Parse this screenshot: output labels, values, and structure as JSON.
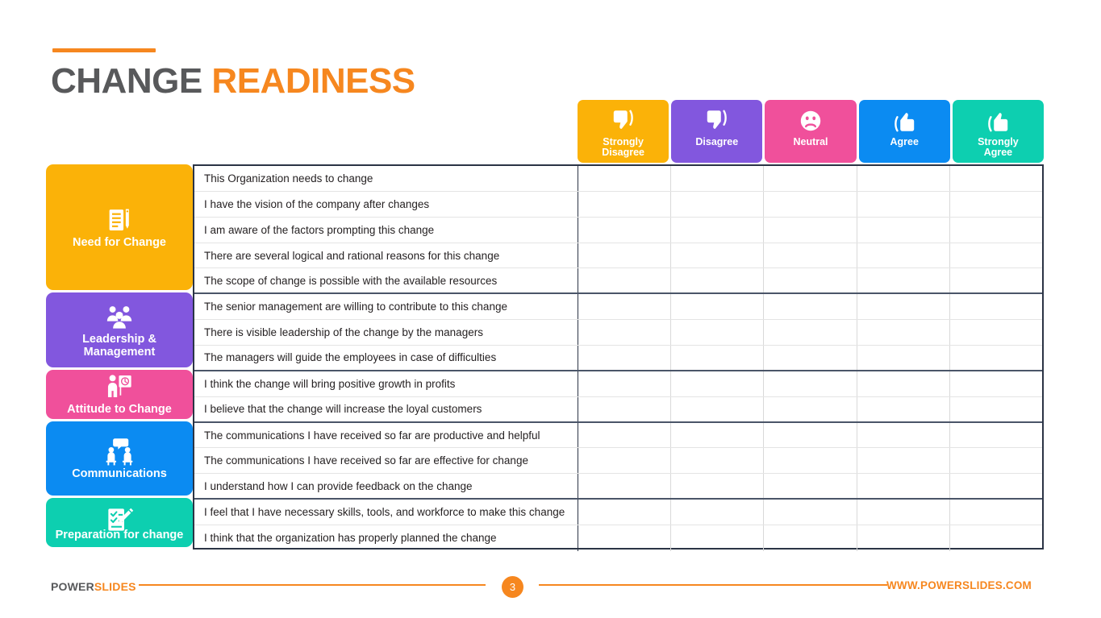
{
  "title": {
    "primary": "CHANGE",
    "accent": "READINESS"
  },
  "colors": {
    "orange_accent": "#F6871F",
    "title_gray": "#58595B",
    "scale_strongly_disagree": "#FBB208",
    "scale_disagree": "#8257DE",
    "scale_neutral": "#F0509B",
    "scale_agree": "#0B8BF2",
    "scale_strongly_agree": "#0DCFB0",
    "table_border": "#2B3445",
    "row_line_light": "#E4E4E4",
    "row_line_dark": "#4A5568"
  },
  "scale_columns": [
    {
      "label": "Strongly\nDisagree",
      "icon": "thumbs-down-icon",
      "color": "#FBB208"
    },
    {
      "label": "Disagree",
      "icon": "thumbs-down-icon",
      "color": "#8257DE"
    },
    {
      "label": "Neutral",
      "icon": "sad-face-icon",
      "color": "#F0509B"
    },
    {
      "label": "Agree",
      "icon": "thumbs-up-icon",
      "color": "#0B8BF2"
    },
    {
      "label": "Strongly\nAgree",
      "icon": "thumbs-up-icon",
      "color": "#0DCFB0"
    }
  ],
  "categories": [
    {
      "label": "Need for Change",
      "icon": "checklist-pencil-icon",
      "color": "#FBB208",
      "rows": 5,
      "overlap": false
    },
    {
      "label": "Leadership &\nManagement",
      "icon": "people-group-icon",
      "color": "#8257DE",
      "rows": 3,
      "overlap": false
    },
    {
      "label": "Attitude to Change",
      "icon": "person-presentation-icon",
      "color": "#F0509B",
      "rows": 2,
      "overlap": false
    },
    {
      "label": "Communications",
      "icon": "people-talking-icon",
      "color": "#0B8BF2",
      "rows": 3,
      "overlap": false
    },
    {
      "label": "Preparation for change",
      "icon": "clipboard-pencil-icon",
      "color": "#0DCFB0",
      "rows": 2,
      "overlap": true
    }
  ],
  "statements": [
    {
      "text": "This Organization needs to change",
      "group": 0,
      "group_end": false
    },
    {
      "text": "I have the vision of the company after changes",
      "group": 0,
      "group_end": false
    },
    {
      "text": "I am aware of the factors prompting this change",
      "group": 0,
      "group_end": false
    },
    {
      "text": "There are several logical and rational reasons for this change",
      "group": 0,
      "group_end": false
    },
    {
      "text": "The scope of change is possible with the available resources",
      "group": 0,
      "group_end": true
    },
    {
      "text": "The senior management are willing to contribute to this change",
      "group": 1,
      "group_end": false
    },
    {
      "text": "There is visible leadership of the change by the managers",
      "group": 1,
      "group_end": false
    },
    {
      "text": "The managers will guide the employees in case of difficulties",
      "group": 1,
      "group_end": true
    },
    {
      "text": "I think the change will bring positive growth in profits",
      "group": 2,
      "group_end": false
    },
    {
      "text": "I believe that the change will increase the loyal customers",
      "group": 2,
      "group_end": true
    },
    {
      "text": "The communications I have received so far are productive and helpful",
      "group": 3,
      "group_end": false
    },
    {
      "text": "The communications I have received so far are effective for change",
      "group": 3,
      "group_end": false
    },
    {
      "text": "I understand how I can provide feedback on the change",
      "group": 3,
      "group_end": true
    },
    {
      "text": "I feel that I have necessary skills, tools, and workforce to make this change",
      "group": 4,
      "group_end": false
    },
    {
      "text": "I think that the organization has properly planned the change",
      "group": 4,
      "group_end": false
    }
  ],
  "footer": {
    "brand_primary": "POWER",
    "brand_accent": "SLIDES",
    "page_number": "3",
    "website": "WWW.POWERSLIDES.COM"
  }
}
